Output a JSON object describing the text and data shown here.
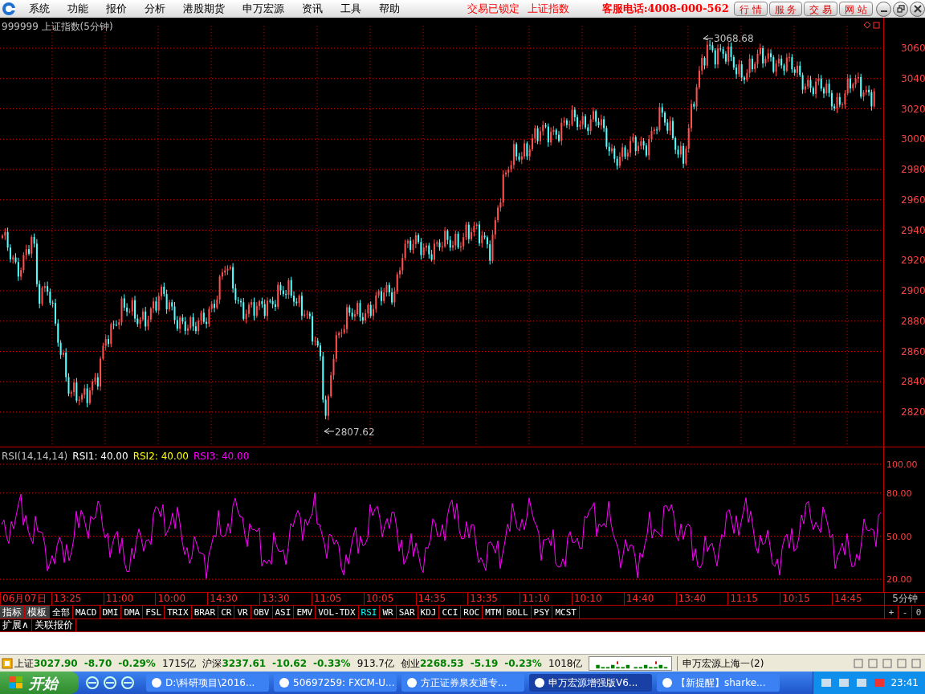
{
  "menu_items": [
    "系统",
    "功能",
    "报价",
    "分析",
    "港股期货",
    "申万宏源",
    "资讯",
    "工具",
    "帮助"
  ],
  "lock_status": "交易已锁定",
  "current_index": "上证指数",
  "hotline": "客服电话:4008-000-562",
  "nav_buttons": [
    "行 情",
    "服 务",
    "交 易",
    "网 站"
  ],
  "chart": {
    "title": "999999 上证指数(5分钟)",
    "price_ticks": [
      "3060",
      "3040",
      "3020",
      "3000",
      "2980",
      "2960",
      "2940",
      "2920",
      "2900",
      "2880",
      "2860",
      "2840",
      "2820"
    ],
    "high_label": "3068.68",
    "low_label": "2807.62"
  },
  "indicator": {
    "name": "RSI(14,14,14)",
    "values": [
      {
        "label": "RSI1: 40.00",
        "color": "#ffffff"
      },
      {
        "label": "RSI2: 40.00",
        "color": "#ffff00"
      },
      {
        "label": "RSI3: 40.00",
        "color": "#ff00ff"
      }
    ],
    "ticks": [
      "100.00",
      "80.00",
      "50.00",
      "20.00"
    ]
  },
  "time_axis": [
    "06月07日",
    "13:25",
    "11:00",
    "10:00",
    "14:30",
    "13:30",
    "11:05",
    "10:05",
    "14:35",
    "13:35",
    "11:10",
    "10:10",
    "14:40",
    "13:40",
    "11:15",
    "10:15",
    "14:45"
  ],
  "period": "5分钟",
  "tabs": [
    {
      "label": "指标",
      "kind": "menu",
      "selected": false
    },
    {
      "label": "模板",
      "kind": "menu",
      "selected": false
    },
    {
      "label": "全部",
      "kind": "tab",
      "selected": false
    },
    {
      "label": "MACD",
      "kind": "tab",
      "selected": false
    },
    {
      "label": "DMI",
      "kind": "tab",
      "selected": false
    },
    {
      "label": "DMA",
      "kind": "tab",
      "selected": false
    },
    {
      "label": "FSL",
      "kind": "tab",
      "selected": false
    },
    {
      "label": "TRIX",
      "kind": "tab",
      "selected": false
    },
    {
      "label": "BRAR",
      "kind": "tab",
      "selected": false
    },
    {
      "label": "CR",
      "kind": "tab",
      "selected": false
    },
    {
      "label": "VR",
      "kind": "tab",
      "selected": false
    },
    {
      "label": "OBV",
      "kind": "tab",
      "selected": false
    },
    {
      "label": "ASI",
      "kind": "tab",
      "selected": false
    },
    {
      "label": "EMV",
      "kind": "tab",
      "selected": false
    },
    {
      "label": "VOL-TDX",
      "kind": "tab",
      "selected": false
    },
    {
      "label": "RSI",
      "kind": "tab",
      "selected": true
    },
    {
      "label": "WR",
      "kind": "tab",
      "selected": false
    },
    {
      "label": "SAR",
      "kind": "tab",
      "selected": false
    },
    {
      "label": "KDJ",
      "kind": "tab",
      "selected": false
    },
    {
      "label": "CCI",
      "kind": "tab",
      "selected": false
    },
    {
      "label": "ROC",
      "kind": "tab",
      "selected": false
    },
    {
      "label": "MTM",
      "kind": "tab",
      "selected": false
    },
    {
      "label": "BOLL",
      "kind": "tab",
      "selected": false
    },
    {
      "label": "PSY",
      "kind": "tab",
      "selected": false
    },
    {
      "label": "MCST",
      "kind": "tab",
      "selected": false
    }
  ],
  "zoom_buttons": [
    "+",
    "-",
    "0"
  ],
  "sub_tabs": [
    "扩展∧",
    "关联报价"
  ],
  "indices": [
    {
      "name": "上证",
      "value": "3027.90",
      "change": "-8.70",
      "pct": "-0.29%",
      "volume": "1715亿"
    },
    {
      "name": "沪深",
      "value": "3237.61",
      "change": "-10.62",
      "pct": "-0.33%",
      "volume": "913.7亿"
    },
    {
      "name": "创业",
      "value": "2268.53",
      "change": "-5.19",
      "pct": "-0.23%",
      "volume": "1018亿"
    }
  ],
  "broker": "申万宏源上海一(2)",
  "taskbar": {
    "start": "开始",
    "windows": [
      {
        "label": "D:\\科研项目\\2016...",
        "selected": false
      },
      {
        "label": "50697259: FXCM-U...",
        "selected": false
      },
      {
        "label": "方正证券泉友通专...",
        "selected": false
      },
      {
        "label": "申万宏源增强版V6...",
        "selected": true
      },
      {
        "label": "【新提醒】sharke...",
        "selected": false
      }
    ],
    "clock": "23:41"
  }
}
